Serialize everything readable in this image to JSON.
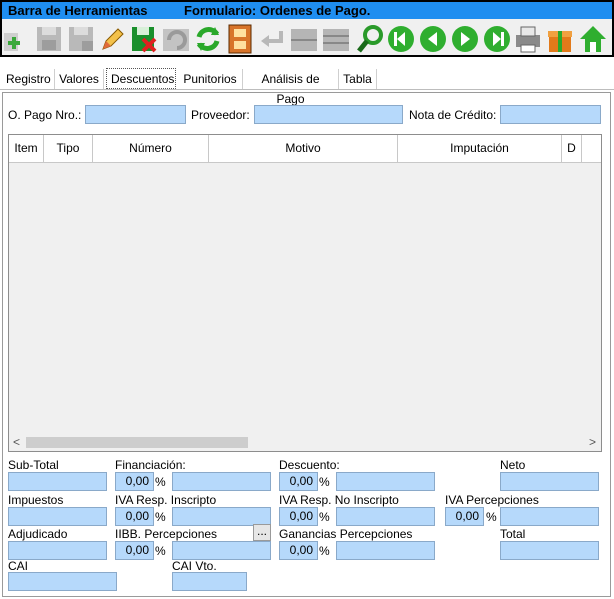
{
  "toolbar": {
    "title": "Barra de Herramientas",
    "form_title": "Formulario: Ordenes de Pago."
  },
  "tabs": [
    {
      "label": "Registro"
    },
    {
      "label": "Valores"
    },
    {
      "label": "Descuentos"
    },
    {
      "label": "Punitorios"
    },
    {
      "label": "Análisis de Pago"
    },
    {
      "label": "Tabla"
    }
  ],
  "header": {
    "pago_label": "O. Pago Nro.:",
    "proveedor_label": "Proveedor:",
    "nota_label": "Nota de Crédito:"
  },
  "grid": {
    "columns": [
      "Item",
      "Tipo",
      "Número",
      "Motivo",
      "Imputación",
      "D"
    ]
  },
  "totals": {
    "subtotal_label": "Sub-Total",
    "financiacion_label": "Financiación:",
    "descuento_label": "Descuento:",
    "neto_label": "Neto",
    "impuestos_label": "Impuestos",
    "iva_ri_label": "IVA Resp. Inscripto",
    "iva_rni_label": "IVA Resp. No Inscripto",
    "iva_perc_label": "IVA Percepciones",
    "adjudicado_label": "Adjudicado",
    "iibb_label": "IIBB. Percepciones",
    "ganancias_label": "Ganancias Percepciones",
    "total_label": "Total",
    "cai_label": "CAI",
    "cai_vto_label": "CAI Vto.",
    "pct_symbol": "%",
    "financiacion_pct": "0,00",
    "descuento_pct": "0,00",
    "iva_ri_pct": "0,00",
    "iva_rni_pct": "0,00",
    "iva_perc_pct": "0,00",
    "iibb_pct": "0,00",
    "ganancias_pct": "0,00",
    "ellipsis": "..."
  },
  "scroll": {
    "left": "<",
    "right": ">"
  }
}
